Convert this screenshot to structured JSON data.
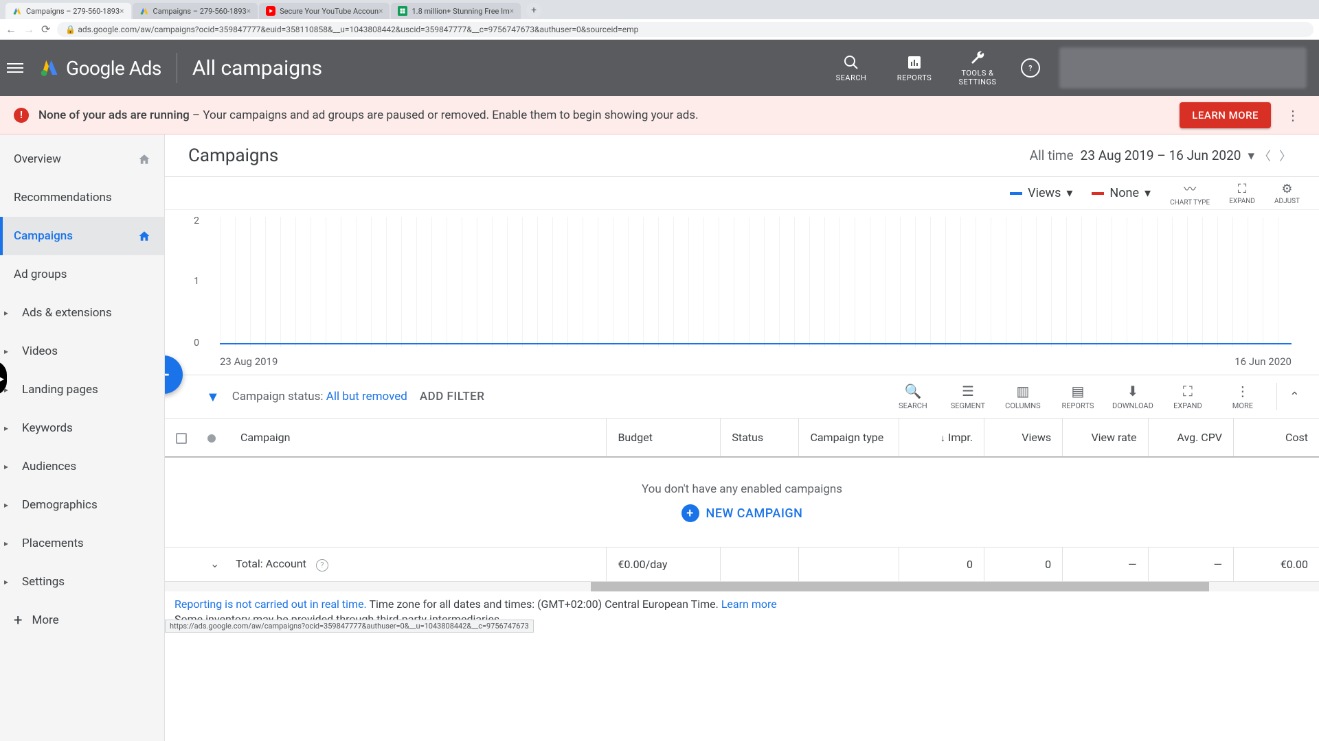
{
  "browser": {
    "tabs": [
      {
        "title": "Campaigns – 279-560-1893",
        "fav": "ads"
      },
      {
        "title": "Campaigns – 279-560-1893",
        "fav": "ads"
      },
      {
        "title": "Secure Your YouTube Accoun",
        "fav": "yt"
      },
      {
        "title": "1.8 million+ Stunning Free Im",
        "fav": "sheet"
      }
    ],
    "url": "ads.google.com/aw/campaigns?ocid=359847777&euid=358110858&__u=1043808442&uscid=359847777&__c=9756747673&authuser=0&sourceid=emp"
  },
  "header": {
    "product": "Google Ads",
    "scope": "All campaigns",
    "actions": {
      "search": "SEARCH",
      "reports": "REPORTS",
      "tools": "TOOLS & SETTINGS"
    }
  },
  "alert": {
    "bold": "None of your ads are running",
    "rest": " – Your campaigns and ad groups are paused or removed. Enable them to begin showing your ads.",
    "cta": "LEARN MORE"
  },
  "sidebar": {
    "items": [
      {
        "label": "Overview",
        "home": true
      },
      {
        "label": "Recommendations"
      },
      {
        "label": "Campaigns",
        "home": true,
        "active": true
      },
      {
        "label": "Ad groups"
      },
      {
        "label": "Ads & extensions",
        "exp": true
      },
      {
        "label": "Videos",
        "exp": true
      },
      {
        "label": "Landing pages",
        "exp": true
      },
      {
        "label": "Keywords",
        "exp": true
      },
      {
        "label": "Audiences",
        "exp": true
      },
      {
        "label": "Demographics",
        "exp": true
      },
      {
        "label": "Placements",
        "exp": true
      },
      {
        "label": "Settings",
        "exp": true
      }
    ],
    "more": "More"
  },
  "page": {
    "title": "Campaigns",
    "date_label": "All time",
    "date_range": "23 Aug 2019 – 16 Jun 2020"
  },
  "chart": {
    "metric_a": "Views",
    "metric_b": "None",
    "tool_type": "CHART TYPE",
    "tool_expand": "EXPAND",
    "tool_adjust": "ADJUST",
    "x_start": "23 Aug 2019",
    "x_end": "16 Jun 2020"
  },
  "chart_data": {
    "type": "line",
    "title": "",
    "xlabel": "",
    "ylabel": "",
    "ylim": [
      0,
      2
    ],
    "y_ticks": [
      0,
      1,
      2
    ],
    "x_range": [
      "23 Aug 2019",
      "16 Jun 2020"
    ],
    "series": [
      {
        "name": "Views",
        "color": "#1a73e8",
        "constant_value": 0
      },
      {
        "name": "None",
        "color": "#d93025",
        "constant_value": null
      }
    ]
  },
  "filters": {
    "label": "Campaign status:",
    "value": "All but removed",
    "add": "ADD FILTER"
  },
  "table_tools": {
    "search": "SEARCH",
    "segment": "SEGMENT",
    "columns": "COLUMNS",
    "reports": "REPORTS",
    "download": "DOWNLOAD",
    "expand": "EXPAND",
    "more": "MORE"
  },
  "table": {
    "cols": {
      "campaign": "Campaign",
      "budget": "Budget",
      "status": "Status",
      "type": "Campaign type",
      "impr": "Impr.",
      "views": "Views",
      "view_rate": "View rate",
      "avg_cpv": "Avg. CPV",
      "cost": "Cost"
    },
    "empty_msg": "You don't have any enabled campaigns",
    "new_btn": "NEW CAMPAIGN",
    "total": {
      "label": "Total: Account",
      "budget": "€0.00/day",
      "impr": "0",
      "views": "0",
      "view_rate": "—",
      "avg_cpv": "—",
      "cost": "€0.00"
    }
  },
  "footer": {
    "link1": "Reporting is not carried out in real time.",
    "text1": " Time zone for all dates and times: (GMT+02:00) Central European Time. ",
    "link2": "Learn more",
    "text2": "Some inventory may be provided through third-party intermediaries.",
    "status": "https://ads.google.com/aw/campaigns?ocid=359847777&authuser=0&__u=1043808442&__c=9756747673"
  }
}
